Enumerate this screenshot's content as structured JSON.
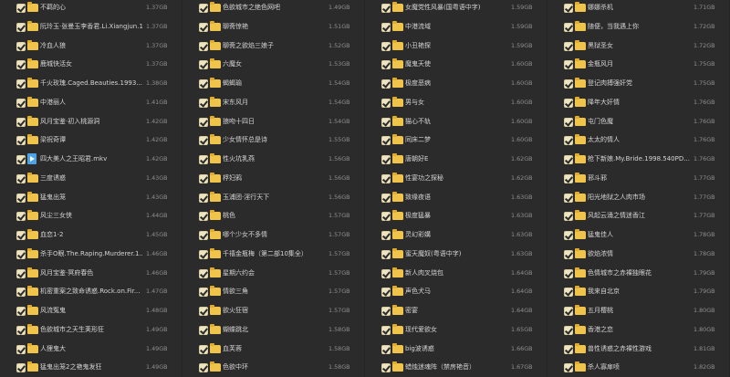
{
  "file_list": {
    "columns": [
      {
        "items": [
          {
            "name": "不羁的心",
            "size": "1.37GB",
            "type": "folder"
          },
          {
            "name": "阮玲玉·张曼玉李香君.Li.Xiangjun.19...",
            "size": "1.37GB",
            "type": "folder"
          },
          {
            "name": "冷血人狼",
            "size": "1.37GB",
            "type": "folder"
          },
          {
            "name": "鹿城快活女",
            "size": "1.37GB",
            "type": "folder"
          },
          {
            "name": "千火玫瑰.Caged.Beauties.1993....",
            "size": "1.38GB",
            "type": "folder"
          },
          {
            "name": "中港丽人",
            "size": "1.41GB",
            "type": "folder"
          },
          {
            "name": "风月宝鉴·初入桃源洞",
            "size": "1.42GB",
            "type": "folder"
          },
          {
            "name": "梁祝奇谭",
            "size": "1.42GB",
            "type": "folder"
          },
          {
            "name": "四大美人之王昭君.mkv",
            "size": "1.42GB",
            "type": "video"
          },
          {
            "name": "三度诱惑",
            "size": "1.43GB",
            "type": "folder"
          },
          {
            "name": "猛鬼出笼",
            "size": "1.43GB",
            "type": "folder"
          },
          {
            "name": "风尘三女侠",
            "size": "1.44GB",
            "type": "folder"
          },
          {
            "name": "血恋1-2",
            "size": "1.45GB",
            "type": "folder"
          },
          {
            "name": "杀手O眼.The.Raping.Murderer.1...",
            "size": "1.46GB",
            "type": "folder"
          },
          {
            "name": "风月宝鉴·冥府春色",
            "size": "1.46GB",
            "type": "folder"
          },
          {
            "name": "机密重案之致命诱惑.Rock.on.Fir...",
            "size": "1.47GB",
            "type": "folder"
          },
          {
            "name": "风流冤鬼",
            "size": "1.48GB",
            "type": "folder"
          },
          {
            "name": "色欲城市之天生荚形狂",
            "size": "1.49GB",
            "type": "folder"
          },
          {
            "name": "人狸鬼大",
            "size": "1.49GB",
            "type": "folder"
          },
          {
            "name": "猛鬼出笼2之艳鬼发狂",
            "size": "1.49GB",
            "type": "folder"
          }
        ]
      },
      {
        "items": [
          {
            "name": "色欲城市之绝色网吧",
            "size": "1.49GB",
            "type": "folder"
          },
          {
            "name": "聊斋惊艳",
            "size": "1.51GB",
            "type": "folder"
          },
          {
            "name": "聊斋之欲焰三娘子",
            "size": "1.52GB",
            "type": "folder"
          },
          {
            "name": "六魔女",
            "size": "1.53GB",
            "type": "folder"
          },
          {
            "name": "蝎蝎瑜",
            "size": "1.54GB",
            "type": "folder"
          },
          {
            "name": "宋东风月",
            "size": "1.54GB",
            "type": "folder"
          },
          {
            "name": "狼吻十四日",
            "size": "1.54GB",
            "type": "folder"
          },
          {
            "name": "少女情怀总是诗",
            "size": "1.55GB",
            "type": "folder"
          },
          {
            "name": "性火坑乳燕",
            "size": "1.56GB",
            "type": "folder"
          },
          {
            "name": "桴妇鸦",
            "size": "1.56GB",
            "type": "folder"
          },
          {
            "name": "玉浦团·淫行天下",
            "size": "1.56GB",
            "type": "folder"
          },
          {
            "name": "桃色",
            "size": "1.57GB",
            "type": "folder"
          },
          {
            "name": "哪个少女不多情",
            "size": "1.57GB",
            "type": "folder"
          },
          {
            "name": "千禧金瓶梅（第二部10集全）",
            "size": "1.57GB",
            "type": "folder"
          },
          {
            "name": "星期六约会",
            "size": "1.57GB",
            "type": "folder"
          },
          {
            "name": "情欲三角",
            "size": "1.57GB",
            "type": "folder"
          },
          {
            "name": "欲火狂宿",
            "size": "1.57GB",
            "type": "folder"
          },
          {
            "name": "蝴蝶跳北",
            "size": "1.58GB",
            "type": "folder"
          },
          {
            "name": "血芙蓉",
            "size": "1.58GB",
            "type": "folder"
          },
          {
            "name": "色欲中环",
            "size": "1.58GB",
            "type": "folder"
          }
        ]
      },
      {
        "items": [
          {
            "name": "女魔党性风暴(国粤语中字)",
            "size": "1.59GB",
            "type": "folder"
          },
          {
            "name": "中港流域",
            "size": "1.59GB",
            "type": "folder"
          },
          {
            "name": "小丑艳探",
            "size": "1.59GB",
            "type": "folder"
          },
          {
            "name": "魔鬼天使",
            "size": "1.60GB",
            "type": "folder"
          },
          {
            "name": "极度恶病",
            "size": "1.60GB",
            "type": "folder"
          },
          {
            "name": "男与女",
            "size": "1.60GB",
            "type": "folder"
          },
          {
            "name": "猫心不轨",
            "size": "1.60GB",
            "type": "folder"
          },
          {
            "name": "同床二梦",
            "size": "1.60GB",
            "type": "folder"
          },
          {
            "name": "唐朝好E",
            "size": "1.62GB",
            "type": "folder"
          },
          {
            "name": "性宴功之探秘",
            "size": "1.62GB",
            "type": "folder"
          },
          {
            "name": "致缘夜语",
            "size": "1.63GB",
            "type": "folder"
          },
          {
            "name": "极度猛暴",
            "size": "1.63GB",
            "type": "folder"
          },
          {
            "name": "灵幻彩媾",
            "size": "1.63GB",
            "type": "folder"
          },
          {
            "name": "蜜天魔奴(粤语中字)",
            "size": "1.63GB",
            "type": "folder"
          },
          {
            "name": "新人肉叉烧包",
            "size": "1.64GB",
            "type": "folder"
          },
          {
            "name": "声色犬马",
            "size": "1.64GB",
            "type": "folder"
          },
          {
            "name": "密宴",
            "size": "1.64GB",
            "type": "folder"
          },
          {
            "name": "现代爱欲女",
            "size": "1.65GB",
            "type": "folder"
          },
          {
            "name": "big波诱惑",
            "size": "1.66GB",
            "type": "folder"
          },
          {
            "name": "蜡烛迷魂阵（禁房艳音）",
            "size": "1.67GB",
            "type": "folder"
          }
        ]
      },
      {
        "items": [
          {
            "name": "娜娜杀机",
            "size": "1.71GB",
            "type": "folder"
          },
          {
            "name": "随便，当我遇上你",
            "size": "1.72GB",
            "type": "folder"
          },
          {
            "name": "黑狱圣女",
            "size": "1.72GB",
            "type": "folder"
          },
          {
            "name": "金瓶风月",
            "size": "1.75GB",
            "type": "folder"
          },
          {
            "name": "登记肉搏强奸党",
            "size": "1.75GB",
            "type": "folder"
          },
          {
            "name": "降年大奸情",
            "size": "1.76GB",
            "type": "folder"
          },
          {
            "name": "屯门色魔",
            "size": "1.76GB",
            "type": "folder"
          },
          {
            "name": "太太的情人",
            "size": "1.76GB",
            "type": "folder"
          },
          {
            "name": "枪下新娘.My.Bride.1998.540PD...",
            "size": "1.76GB",
            "type": "folder"
          },
          {
            "name": "邪斗邪",
            "size": "1.77GB",
            "type": "folder"
          },
          {
            "name": "阳光地狱之人肉市场",
            "size": "1.77GB",
            "type": "folder"
          },
          {
            "name": "风起云涌之情迷香江",
            "size": "1.77GB",
            "type": "folder"
          },
          {
            "name": "猛鬼佳人",
            "size": "1.78GB",
            "type": "folder"
          },
          {
            "name": "欲焰浓情",
            "size": "1.78GB",
            "type": "folder"
          },
          {
            "name": "色情城市之赤裸独眼花",
            "size": "1.79GB",
            "type": "folder"
          },
          {
            "name": "我来自北京",
            "size": "1.79GB",
            "type": "folder"
          },
          {
            "name": "五月樱桃",
            "size": "1.80GB",
            "type": "folder"
          },
          {
            "name": "香港之恋",
            "size": "1.80GB",
            "type": "folder"
          },
          {
            "name": "兽性诱惑之赤裸性游戏",
            "size": "1.81GB",
            "type": "folder"
          },
          {
            "name": "杀人寡扉喷",
            "size": "1.82GB",
            "type": "folder"
          }
        ]
      }
    ]
  }
}
